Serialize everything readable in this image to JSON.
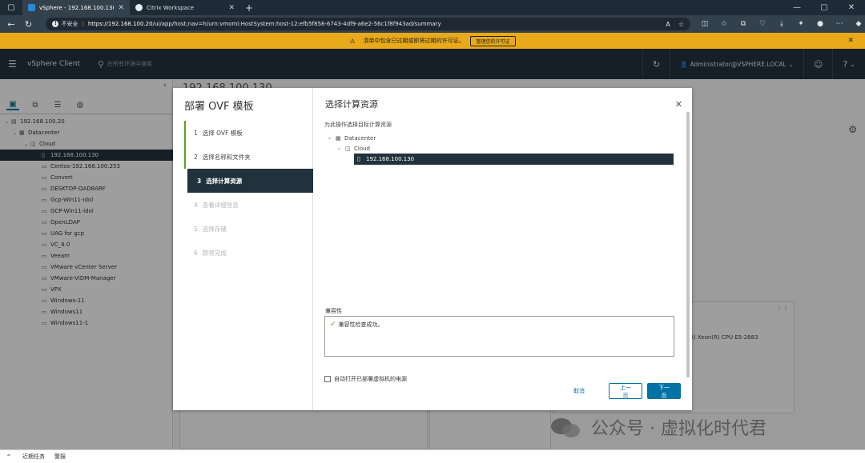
{
  "browser": {
    "tabs": [
      {
        "title": "vSphere - 192.168.100.130 - 摘要",
        "active": true
      },
      {
        "title": "Citrix Workspace",
        "active": false
      }
    ],
    "security_label": "不安全",
    "url_host": "https://192.168.100.20",
    "url_path": "/ui/app/host;nav=h/urn:vmomi:HostSystem:host-12:efb5f858-6743-4df9-a6e2-56c1f8f943ad/summary"
  },
  "banner": {
    "message": "清单中包含已过期或即将过期的许可证。",
    "button": "管理您的许可证"
  },
  "header": {
    "brand": "vSphere Client",
    "search_placeholder": "在所有环境中搜索",
    "user": "Administrator@VSPHERE.LOCAL"
  },
  "inventory": {
    "vcenter": "192.168.100.20",
    "datacenter": "Datacenter",
    "cluster": "Cloud",
    "host": "192.168.100.130",
    "vms": [
      "Centos-192.168.100.253",
      "Convert",
      "DESKTOP-QAD8ARF",
      "Gcp-Win11-idol",
      "GCP-Win11-idol",
      "OpenLDAP",
      "UAG for gcp",
      "VC_8.0",
      "Veeam",
      "VMware vCenter Server",
      "VMware-VIDM-Manager",
      "VPX",
      "Windows-11",
      "Windows11",
      "Windows11-1"
    ]
  },
  "background": {
    "page_title": "192.168.100.130",
    "cpu_text": "el(R) Xeon(R) CPU E5-2683"
  },
  "dialog": {
    "title": "部署 OVF 模板",
    "steps": [
      {
        "num": "1",
        "label": "选择 OVF 模板",
        "state": "done"
      },
      {
        "num": "2",
        "label": "选择名称和文件夹",
        "state": "done"
      },
      {
        "num": "3",
        "label": "选择计算资源",
        "state": "active"
      },
      {
        "num": "4",
        "label": "查看详细信息",
        "state": "pending"
      },
      {
        "num": "5",
        "label": "选择存储",
        "state": "pending"
      },
      {
        "num": "6",
        "label": "即将完成",
        "state": "pending"
      }
    ],
    "page_title": "选择计算资源",
    "subtitle": "为此操作选择目标计算资源",
    "tree": {
      "datacenter": "Datacenter",
      "cluster": "Cloud",
      "host": "192.168.100.130"
    },
    "compat_label": "兼容性",
    "compat_message": "兼容性检查成功。",
    "power_on_label": "自动打开已部署虚拟机的电源",
    "buttons": {
      "cancel": "取消",
      "back": "上一页",
      "next": "下一页"
    }
  },
  "bottom": {
    "tasks": "近期任务",
    "alarms": "警报"
  },
  "watermark": "公众号 · 虚拟化时代君"
}
